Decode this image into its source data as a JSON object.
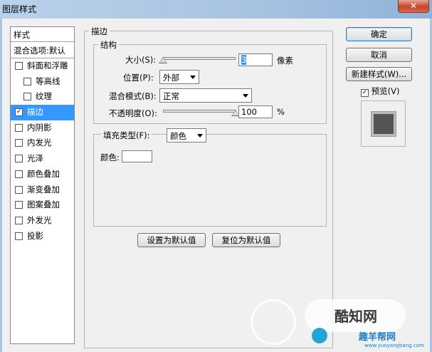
{
  "window": {
    "title": "图层样式",
    "close_glyph": "✕"
  },
  "sidebar": {
    "header": "样式",
    "blend_options": "混合选项:默认",
    "items": [
      {
        "label": "斜面和浮雕",
        "checked": false,
        "indent": false,
        "selected": false
      },
      {
        "label": "等高线",
        "checked": false,
        "indent": true,
        "selected": false
      },
      {
        "label": "纹理",
        "checked": false,
        "indent": true,
        "selected": false
      },
      {
        "label": "描边",
        "checked": true,
        "indent": false,
        "selected": true
      },
      {
        "label": "内阴影",
        "checked": false,
        "indent": false,
        "selected": false
      },
      {
        "label": "内发光",
        "checked": false,
        "indent": false,
        "selected": false
      },
      {
        "label": "光泽",
        "checked": false,
        "indent": false,
        "selected": false
      },
      {
        "label": "颜色叠加",
        "checked": false,
        "indent": false,
        "selected": false
      },
      {
        "label": "渐变叠加",
        "checked": false,
        "indent": false,
        "selected": false
      },
      {
        "label": "图案叠加",
        "checked": false,
        "indent": false,
        "selected": false
      },
      {
        "label": "外发光",
        "checked": false,
        "indent": false,
        "selected": false
      },
      {
        "label": "投影",
        "checked": false,
        "indent": false,
        "selected": false
      }
    ]
  },
  "stroke": {
    "section_title": "描边",
    "structure_title": "结构",
    "size_label": "大小(S):",
    "size_value": "3",
    "size_unit": "像素",
    "position_label": "位置(P):",
    "position_value": "外部",
    "blend_mode_label": "混合模式(B):",
    "blend_mode_value": "正常",
    "opacity_label": "不透明度(O):",
    "opacity_value": "100",
    "opacity_unit": "%",
    "fill_type_label": "填充类型(F):",
    "fill_type_value": "颜色",
    "color_label": "颜色:",
    "color_value": "#ffffff",
    "size_slider_fraction": 0.0,
    "opacity_slider_fraction": 1.0
  },
  "footer_buttons": {
    "make_default": "设置为默认值",
    "reset_default": "复位为默认值"
  },
  "actions": {
    "ok": "确定",
    "cancel": "取消",
    "new_style": "新建样式(W)...",
    "preview_label": "预览(V)",
    "preview_checked": true
  },
  "watermark": {
    "brand": "酷知网",
    "site": "趣羊帮网",
    "url": "www.yueyangbang.com"
  }
}
